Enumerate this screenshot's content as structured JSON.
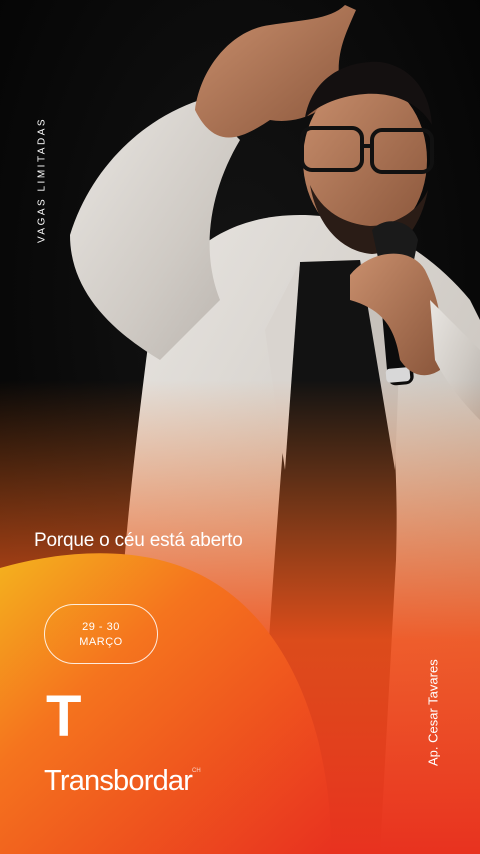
{
  "story": {
    "side_label": "VAGAS LIMITADAS",
    "tagline": "Porque o céu está aberto",
    "date": {
      "days": "29 - 30",
      "month": "MARÇO"
    },
    "logo_letter": "T",
    "brand_name": "Transbordar",
    "brand_mark": "CH",
    "speaker": "Ap. Cesar Tavares"
  },
  "colors": {
    "background": "#050505",
    "accent_orange": "#f5741e",
    "accent_red": "#e8321f",
    "text": "#ffffff"
  }
}
